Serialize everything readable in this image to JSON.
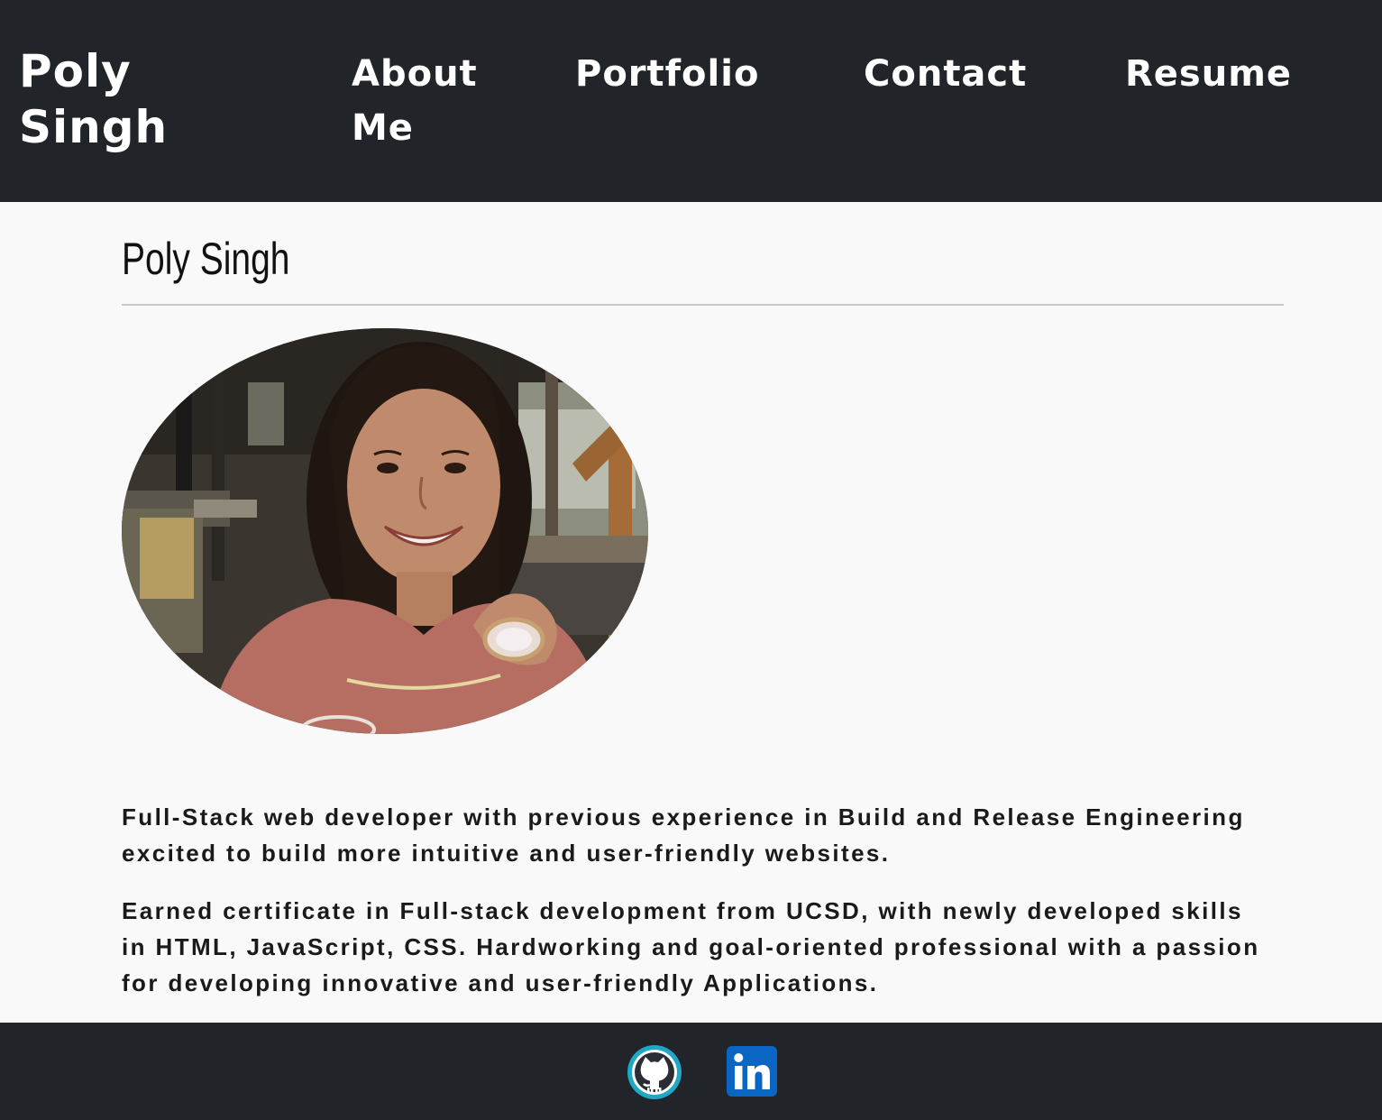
{
  "header": {
    "brand": "Poly Singh",
    "nav": [
      {
        "label": "About Me"
      },
      {
        "label": "Portfolio"
      },
      {
        "label": "Contact"
      },
      {
        "label": "Resume"
      }
    ]
  },
  "main": {
    "title": "Poly Singh",
    "photo_alt": "Poly Singh",
    "bio": [
      "Full-Stack web developer with previous experience in Build and Release Engineering excited to build more intuitive and user-friendly websites.",
      "Earned certificate in Full-stack development from UCSD, with newly developed skills in HTML, JavaScript, CSS. Hardworking and goal-oriented professional with a passion for developing innovative and user-friendly Applications."
    ]
  },
  "footer": {
    "social": [
      {
        "icon": "github-icon",
        "color": "#1fa7c4"
      },
      {
        "icon": "linkedin-icon",
        "color": "#0a66c2"
      }
    ]
  },
  "colors": {
    "header_bg": "#212429",
    "page_bg": "#f9f9f9",
    "text": "#1a1a1a"
  }
}
